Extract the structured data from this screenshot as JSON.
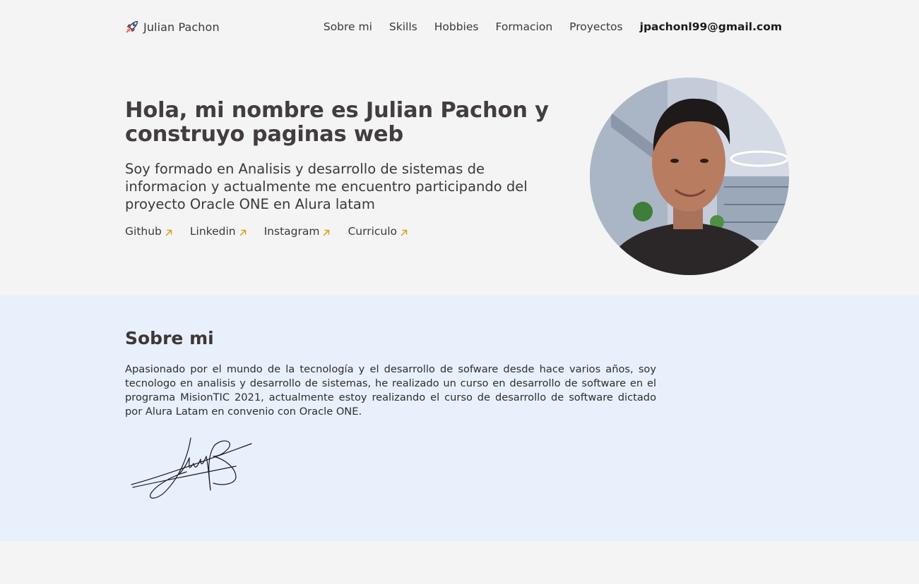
{
  "header": {
    "brand_name": "Julian Pachon",
    "nav": {
      "sobre_mi": "Sobre mi",
      "skills": "Skills",
      "hobbies": "Hobbies",
      "formacion": "Formacion",
      "proyectos": "Proyectos",
      "email": "jpachonl99@gmail.com"
    }
  },
  "hero": {
    "title": "Hola, mi nombre es Julian Pachon y construyo paginas web",
    "subtitle": "Soy formado en Analisis y desarrollo de sistemas de informacion y actualmente me encuentro participando del proyecto Oracle ONE en Alura latam",
    "links": {
      "github": "Github",
      "linkedin": "Linkedin",
      "instagram": "Instagram",
      "curriculo": "Curriculo"
    }
  },
  "about": {
    "title": "Sobre mi",
    "text": "Apasionado por el mundo de la tecnología y el desarrollo de sofware desde hace varios años, soy tecnologo en analisis y desarrollo de sistemas, he realizado un curso en desarrollo de software en el programa MisionTIC 2021, actualmente estoy realizando el curso de desarrollo de software dictado por Alura Latam en convenio con Oracle ONE."
  },
  "icons": {
    "brand": "rocket-icon",
    "external_link": "arrow-up-right-icon"
  },
  "colors": {
    "background": "#f4f4f4",
    "about_background": "#e8f0fc",
    "heading": "#433d3e",
    "link_arrow": "#d4a017"
  }
}
